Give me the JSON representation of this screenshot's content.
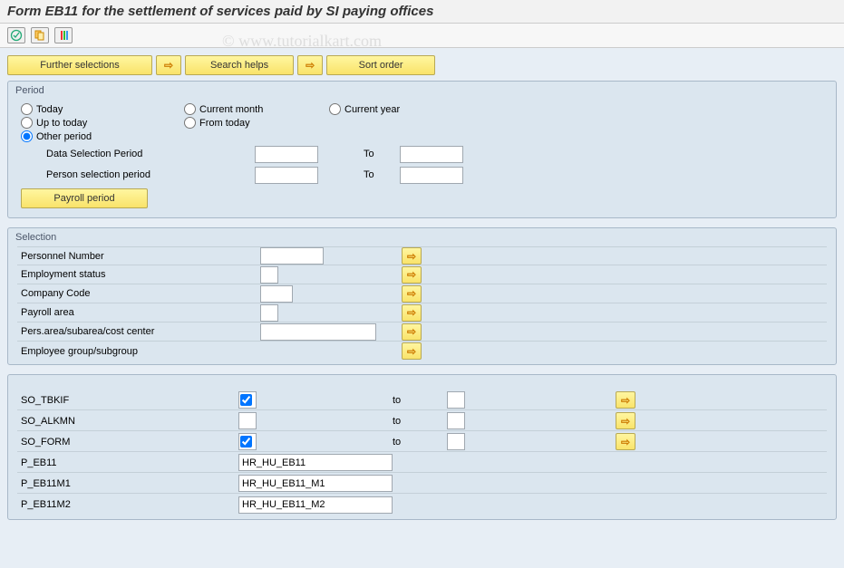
{
  "title": "Form EB11 for the settlement of services paid by SI paying offices",
  "toolbar": {
    "execute_icon": "execute",
    "variant_icon": "variant",
    "status_icon": "status"
  },
  "buttons": {
    "further_selections": "Further selections",
    "search_helps": "Search helps",
    "sort_order": "Sort order",
    "payroll_period": "Payroll period"
  },
  "period": {
    "title": "Period",
    "today": "Today",
    "current_month": "Current month",
    "current_year": "Current year",
    "up_to_today": "Up to today",
    "from_today": "From today",
    "other_period": "Other period",
    "selected": "other_period",
    "data_selection_period": "Data Selection Period",
    "person_selection_period": "Person selection period",
    "to": "To",
    "data_from": "",
    "data_to": "",
    "person_from": "",
    "person_to": ""
  },
  "selection": {
    "title": "Selection",
    "rows": [
      {
        "label": "Personnel Number",
        "width": "w60",
        "value": ""
      },
      {
        "label": "Employment status",
        "width": "w30",
        "value": ""
      },
      {
        "label": "Company Code",
        "width": "w40",
        "value": ""
      },
      {
        "label": "Payroll area",
        "width": "w30",
        "value": ""
      },
      {
        "label": "Pers.area/subarea/cost center",
        "width": "w100",
        "value": ""
      },
      {
        "label": "Employee group/subgroup",
        "width": "",
        "value": ""
      }
    ]
  },
  "params": {
    "to": "to",
    "so_rows": [
      {
        "label": "SO_TBKIF",
        "from": "",
        "checked": true,
        "to": ""
      },
      {
        "label": "SO_ALKMN",
        "from": "",
        "checked": false,
        "to": ""
      },
      {
        "label": "SO_FORM",
        "from": "",
        "checked": true,
        "to": ""
      }
    ],
    "p_rows": [
      {
        "label": "P_EB11",
        "value": "HR_HU_EB11"
      },
      {
        "label": "P_EB11M1",
        "value": "HR_HU_EB11_M1"
      },
      {
        "label": "P_EB11M2",
        "value": "HR_HU_EB11_M2"
      }
    ]
  },
  "watermark": "© www.tutorialkart.com"
}
